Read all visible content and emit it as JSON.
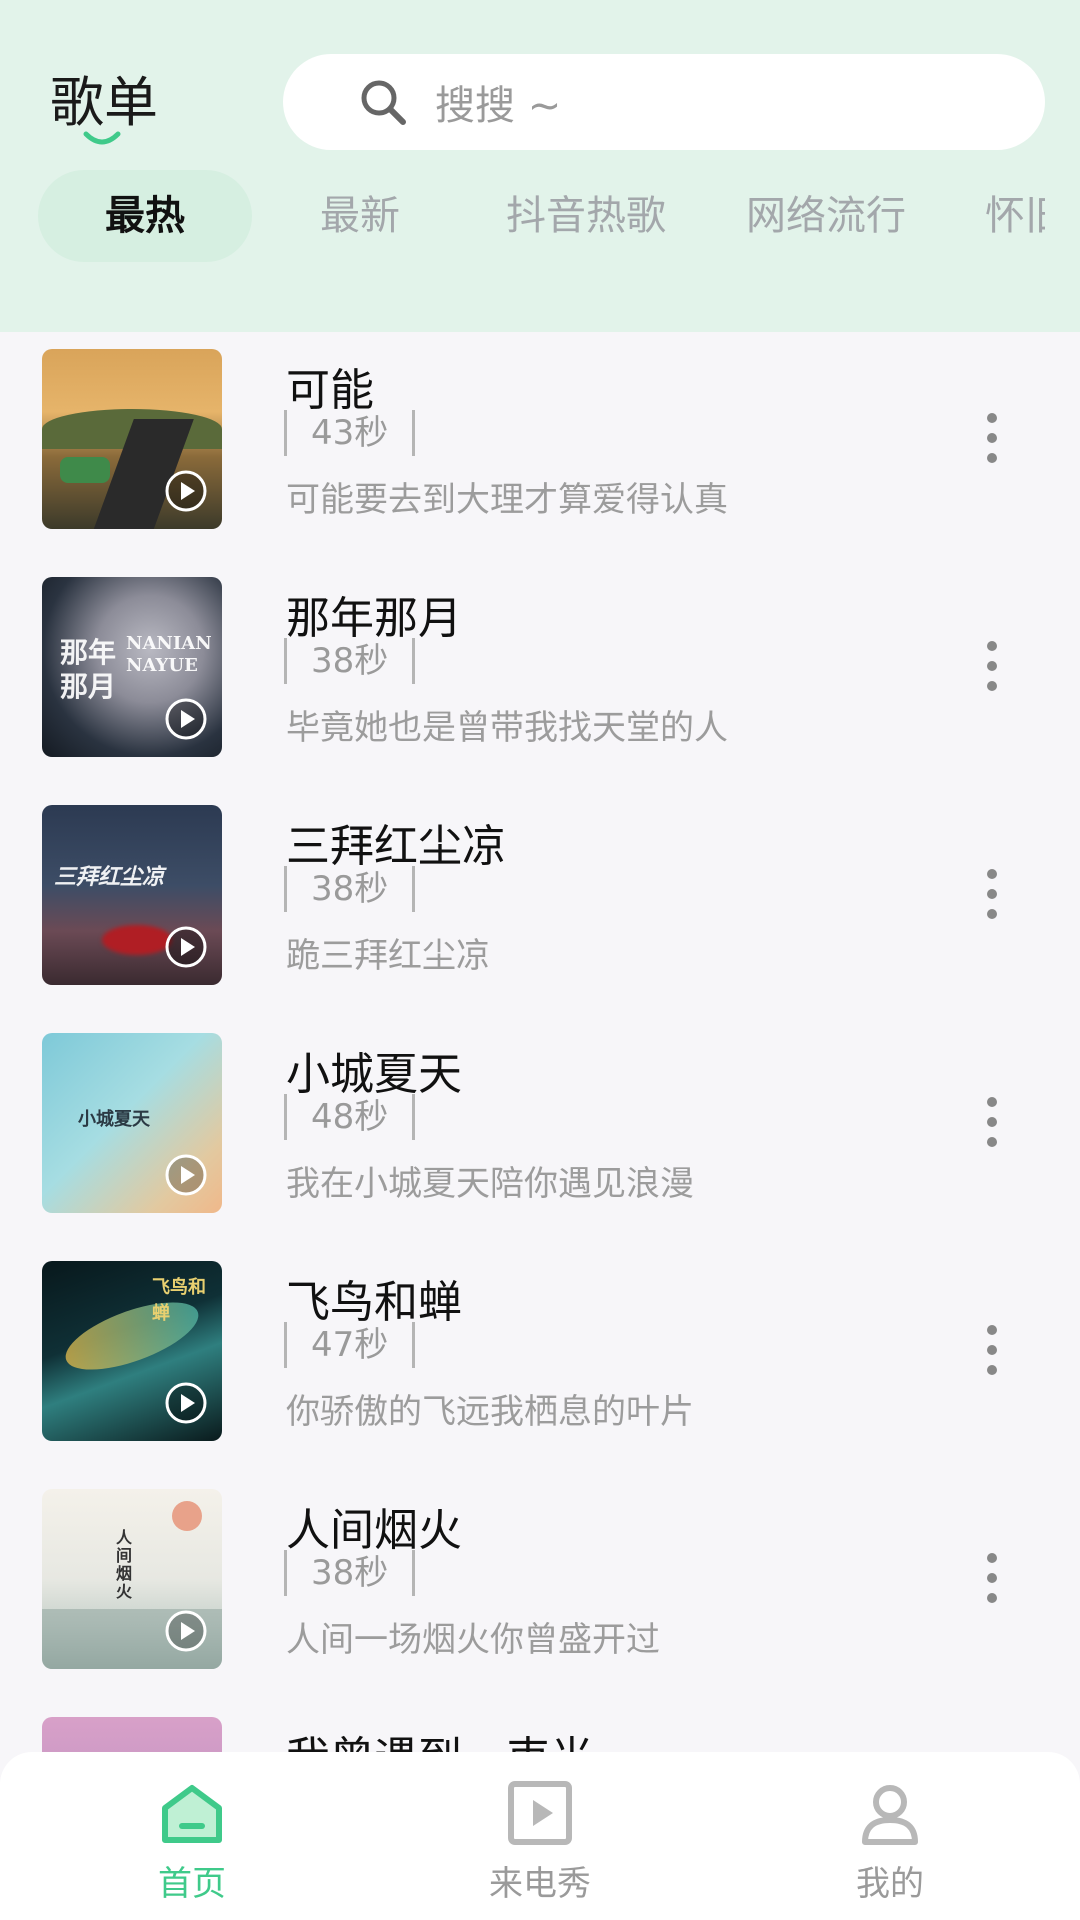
{
  "header": {
    "title": "歌单",
    "search_placeholder": "搜搜 ~"
  },
  "tabs": [
    {
      "label": "最热",
      "active": true
    },
    {
      "label": "最新",
      "active": false
    },
    {
      "label": "抖音热歌",
      "active": false
    },
    {
      "label": "网络流行",
      "active": false
    },
    {
      "label": "怀旧",
      "active": false
    }
  ],
  "songs": [
    {
      "title": "可能",
      "duration": "43秒",
      "lyric": "可能要去到大理才算爱得认真"
    },
    {
      "title": "那年那月",
      "duration": "38秒",
      "lyric": "毕竟她也是曾带我找天堂的人",
      "cover_text_1": "那年",
      "cover_text_2": "那月",
      "cover_text_en": "NANIAN NAYUE"
    },
    {
      "title": "三拜红尘凉",
      "duration": "38秒",
      "lyric": "跪三拜红尘凉",
      "cover_text_1": "三拜红尘凉"
    },
    {
      "title": "小城夏天",
      "duration": "48秒",
      "lyric": "我在小城夏天陪你遇见浪漫",
      "cover_text_1": "小城夏天"
    },
    {
      "title": "飞鸟和蝉",
      "duration": "47秒",
      "lyric": "你骄傲的飞远我栖息的叶片",
      "cover_text_1": "飞鸟和蝉"
    },
    {
      "title": "人间烟火",
      "duration": "38秒",
      "lyric": "人间一场烟火你曾盛开过",
      "cover_text_1": "人间烟火"
    },
    {
      "title": "我曾遇到一束光",
      "duration": "",
      "lyric": ""
    }
  ],
  "nav": [
    {
      "label": "首页",
      "icon": "home-icon",
      "active": true
    },
    {
      "label": "来电秀",
      "icon": "video-play-icon",
      "active": false
    },
    {
      "label": "我的",
      "icon": "user-icon",
      "active": false
    }
  ],
  "colors": {
    "header_bg": "#e2f3ea",
    "active_tab_bg": "#d6efe1",
    "accent": "#3fca8a"
  }
}
